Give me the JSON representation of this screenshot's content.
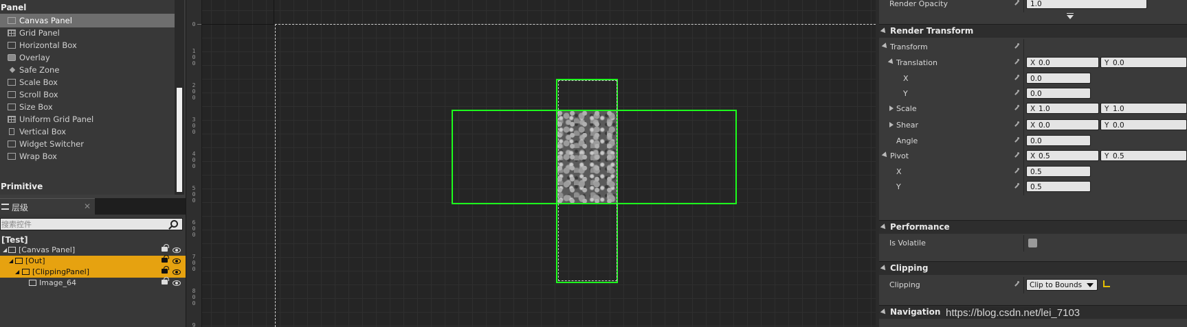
{
  "palette": {
    "category_panel": "Panel",
    "items": [
      {
        "label": "Canvas Panel",
        "icon": "canvas-panel-icon"
      },
      {
        "label": "Grid Panel",
        "icon": "grid-panel-icon"
      },
      {
        "label": "Horizontal Box",
        "icon": "horizontal-box-icon"
      },
      {
        "label": "Overlay",
        "icon": "overlay-icon"
      },
      {
        "label": "Safe Zone",
        "icon": "safe-zone-icon"
      },
      {
        "label": "Scale Box",
        "icon": "scale-box-icon"
      },
      {
        "label": "Scroll Box",
        "icon": "scroll-box-icon"
      },
      {
        "label": "Size Box",
        "icon": "size-box-icon"
      },
      {
        "label": "Uniform Grid Panel",
        "icon": "uniform-grid-panel-icon"
      },
      {
        "label": "Vertical Box",
        "icon": "vertical-box-icon"
      },
      {
        "label": "Widget Switcher",
        "icon": "widget-switcher-icon"
      },
      {
        "label": "Wrap Box",
        "icon": "wrap-box-icon"
      }
    ],
    "category_primitive": "Primitive"
  },
  "hierarchy": {
    "tab_label": "层级",
    "tab_close": "✕",
    "search_placeholder": "搜索控件",
    "root": "[Test]",
    "nodes": [
      {
        "label": "[Canvas Panel]",
        "selected": false
      },
      {
        "label": "[Out]",
        "selected": true
      },
      {
        "label": "[ClippingPanel]",
        "selected": true
      },
      {
        "label": "Image_64",
        "selected": false
      }
    ]
  },
  "ruler": {
    "labels": [
      "0",
      "1\n0\n0",
      "2\n0\n0",
      "3\n0\n0",
      "4\n0\n0",
      "5\n0\n0",
      "6\n0\n0",
      "7\n0\n0",
      "8\n0\n0",
      "9"
    ]
  },
  "details": {
    "render_opacity_label": "Render Opacity",
    "render_opacity_value": "1.0",
    "render_transform_section": "Render Transform",
    "transform_label": "Transform",
    "translation_label": "Translation",
    "translation_x": "0.0",
    "translation_y": "0.0",
    "x_label": "X",
    "y_label": "Y",
    "scale_label": "Scale",
    "scale_x": "1.0",
    "scale_y": "1.0",
    "shear_label": "Shear",
    "shear_x": "0.0",
    "shear_y": "0.0",
    "angle_label": "Angle",
    "angle_value": "0.0",
    "pivot_label": "Pivot",
    "pivot_x": "0.5",
    "pivot_y": "0.5",
    "performance_section": "Performance",
    "is_volatile_label": "Is Volatile",
    "is_volatile_checked": false,
    "clipping_section": "Clipping",
    "clipping_label": "Clipping",
    "clipping_value": "Clip to Bounds",
    "navigation_section": "Navigation",
    "axis_x": "X",
    "axis_y": "Y"
  },
  "watermark": "https://blog.csdn.net/lei_7103",
  "colors": {
    "selection_orange": "#e6a210",
    "widget_outline_green": "#1dff1d"
  }
}
